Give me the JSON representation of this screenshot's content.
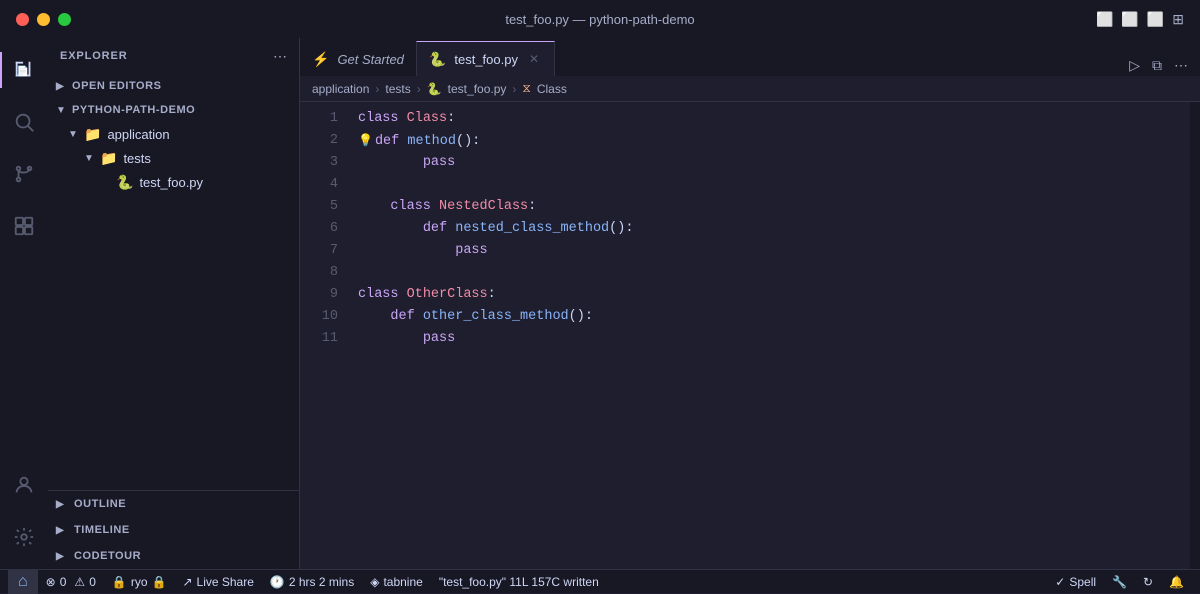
{
  "titlebar": {
    "title": "test_foo.py — python-path-demo",
    "buttons": [
      "close",
      "minimize",
      "maximize"
    ]
  },
  "tabs": {
    "items": [
      {
        "id": "get-started",
        "label": "Get Started",
        "icon": "⚡",
        "active": false,
        "closeable": false
      },
      {
        "id": "test-foo",
        "label": "test_foo.py",
        "icon": "🐍",
        "active": true,
        "closeable": true
      }
    ],
    "right_buttons": [
      "run",
      "split",
      "more"
    ]
  },
  "breadcrumb": {
    "parts": [
      "application",
      ">",
      "tests",
      ">",
      "test_foo.py",
      ">",
      "Class"
    ]
  },
  "sidebar": {
    "title": "EXPLORER",
    "more_icon": "⋯",
    "sections": {
      "open_editors": "OPEN EDITORS",
      "project": "PYTHON-PATH-DEMO",
      "outline": "OUTLINE",
      "timeline": "TIMELINE",
      "codetour": "CODETOUR"
    },
    "tree": {
      "application": "application",
      "tests": "tests",
      "file": "test_foo.py"
    }
  },
  "code": {
    "lines": [
      {
        "num": 1,
        "text": "class Class:"
      },
      {
        "num": 2,
        "text": "    def method():",
        "has_lightbulb": true
      },
      {
        "num": 3,
        "text": "        pass"
      },
      {
        "num": 4,
        "text": ""
      },
      {
        "num": 5,
        "text": "    class NestedClass:"
      },
      {
        "num": 6,
        "text": "        def nested_class_method():"
      },
      {
        "num": 7,
        "text": "            pass"
      },
      {
        "num": 8,
        "text": ""
      },
      {
        "num": 9,
        "text": "class OtherClass:"
      },
      {
        "num": 10,
        "text": "    def other_class_method():"
      },
      {
        "num": 11,
        "text": "        pass"
      }
    ]
  },
  "statusbar": {
    "left_icon": "🔵",
    "errors": "0",
    "warnings": "0",
    "user": "ryo",
    "live_share": "Live Share",
    "time": "2 hrs 2 mins",
    "tabnine": "tabnine",
    "file_info": "\"test_foo.py\" 11L 157C written",
    "spell": "Spell",
    "extension_icon": "🔧",
    "sync_icon": "🔄",
    "bell_icon": "🔔"
  }
}
